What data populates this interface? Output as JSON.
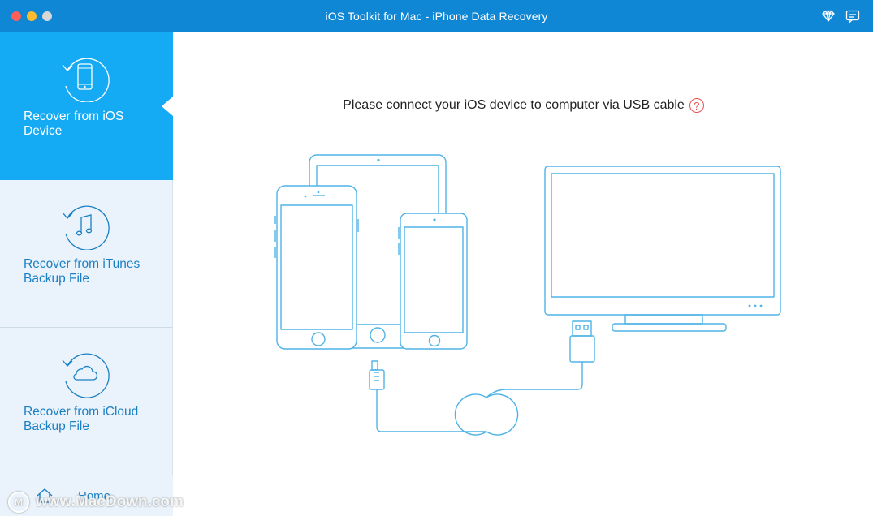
{
  "window": {
    "title": "iOS Toolkit for Mac - iPhone Data Recovery"
  },
  "sidebar": {
    "items": [
      {
        "label": "Recover from iOS Device",
        "icon": "phone-restore-icon",
        "active": true
      },
      {
        "label": "Recover from iTunes Backup File",
        "icon": "music-restore-icon",
        "active": false
      },
      {
        "label": "Recover from iCloud Backup File",
        "icon": "cloud-restore-icon",
        "active": false
      }
    ],
    "home_label": "Home"
  },
  "main": {
    "instruction": "Please connect your iOS device to computer via USB cable",
    "help_glyph": "?"
  },
  "watermark": {
    "text": "www.MacDown.com",
    "logo_letter": "M"
  },
  "colors": {
    "titlebar": "#0f87d4",
    "active_item": "#15aaf4",
    "sidebar_bg": "#eaf3fb",
    "link_text": "#1b7fc4",
    "illustration_stroke": "#4fb3e6",
    "help": "#e65151"
  }
}
